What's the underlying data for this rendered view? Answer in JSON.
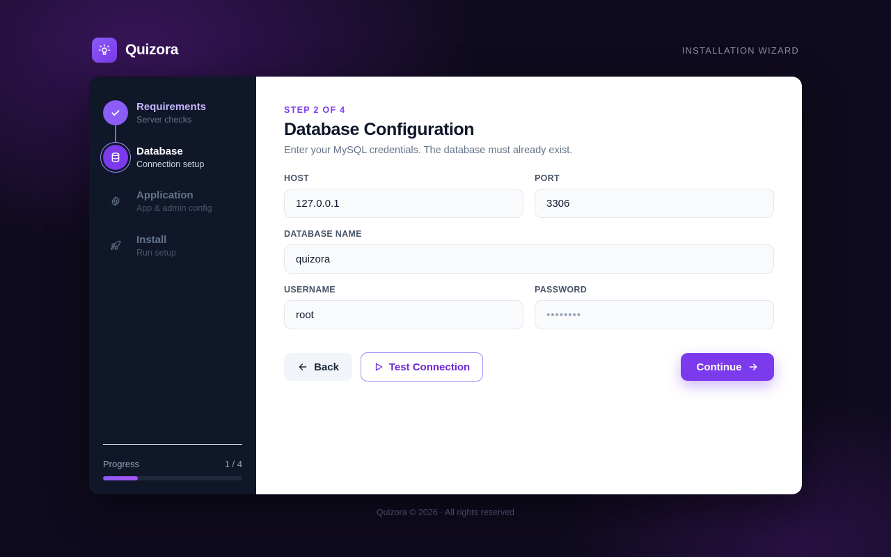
{
  "header": {
    "brand": "Quizora",
    "wizard_label": "INSTALLATION WIZARD",
    "logo_icon": "lightbulb-icon"
  },
  "sidebar": {
    "steps": [
      {
        "title": "Requirements",
        "subtitle": "Server checks",
        "status": "done",
        "icon": "check-icon"
      },
      {
        "title": "Database",
        "subtitle": "Connection setup",
        "status": "active",
        "icon": "database-icon"
      },
      {
        "title": "Application",
        "subtitle": "App & admin config",
        "status": "todo",
        "icon": "gear-icon"
      },
      {
        "title": "Install",
        "subtitle": "Run setup",
        "status": "todo",
        "icon": "rocket-icon"
      }
    ],
    "progress": {
      "label": "Progress",
      "value_text": "1 / 4",
      "fraction": 0.25
    }
  },
  "main": {
    "eyebrow": "STEP 2 OF 4",
    "title": "Database Configuration",
    "description": "Enter your MySQL credentials. The database must already exist.",
    "fields": {
      "host": {
        "label": "HOST",
        "value": "127.0.0.1"
      },
      "port": {
        "label": "PORT",
        "value": "3306"
      },
      "database_name": {
        "label": "DATABASE NAME",
        "value": "quizora"
      },
      "username": {
        "label": "USERNAME",
        "value": "root"
      },
      "password": {
        "label": "PASSWORD",
        "value": "••••••••"
      }
    },
    "buttons": {
      "back": "Back",
      "test_connection": "Test Connection",
      "continue": "Continue"
    }
  },
  "footer": {
    "text": "Quizora © 2026 · All rights reserved"
  },
  "colors": {
    "accent": "#7c3aed",
    "accent_light": "#8b5cf6",
    "sidebar_bg": "#0f1729",
    "page_bg": "#0f0b1e"
  }
}
